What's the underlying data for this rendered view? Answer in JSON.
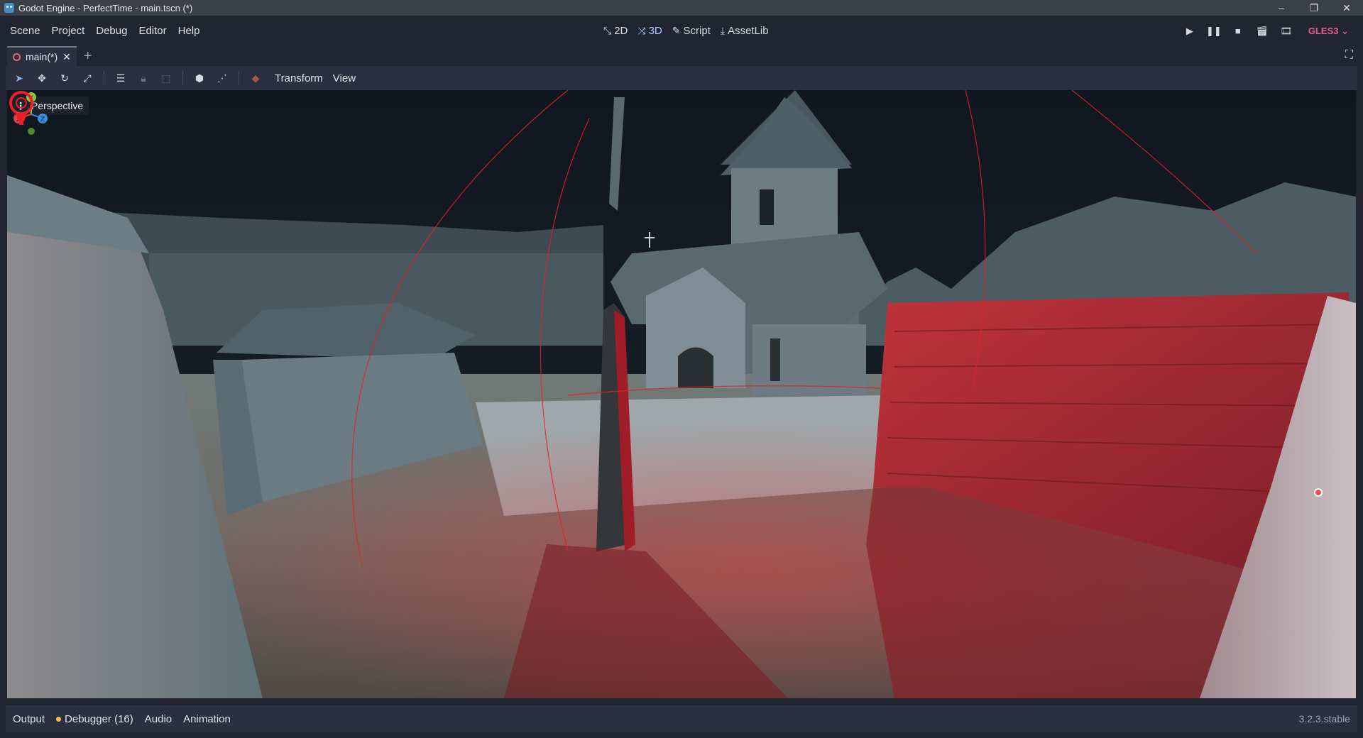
{
  "window": {
    "title": "Godot Engine - PerfectTime - main.tscn (*)",
    "controls": {
      "minimize": "–",
      "maximize": "❐",
      "close": "✕"
    }
  },
  "menu": {
    "items": [
      "Scene",
      "Project",
      "Debug",
      "Editor",
      "Help"
    ]
  },
  "workspaces": {
    "items": [
      {
        "label": "2D",
        "icon": "2d-icon",
        "active": false
      },
      {
        "label": "3D",
        "icon": "3d-icon",
        "active": true
      },
      {
        "label": "Script",
        "icon": "script-icon",
        "active": false
      },
      {
        "label": "AssetLib",
        "icon": "assetlib-icon",
        "active": false
      }
    ]
  },
  "renderer": {
    "label": "GLES3"
  },
  "tabs": {
    "items": [
      {
        "label": "main(*)",
        "close": "✕"
      }
    ],
    "add": "+"
  },
  "toolbar": {
    "transform_label": "Transform",
    "view_label": "View"
  },
  "viewport": {
    "perspective_label": "Perspective",
    "gizmo_axes": {
      "y": "Y",
      "x": "X",
      "z": "Z"
    }
  },
  "bottom": {
    "output_label": "Output",
    "debugger_label": "Debugger (16)",
    "audio_label": "Audio",
    "animation_label": "Animation",
    "version": "3.2.3.stable"
  },
  "colors": {
    "accent": "#478cbf",
    "active_workspace": "#a8c8ff",
    "renderer": "#e85d90",
    "debugger_dot": "#f5c542",
    "light_gizmo": "#e8202a"
  }
}
